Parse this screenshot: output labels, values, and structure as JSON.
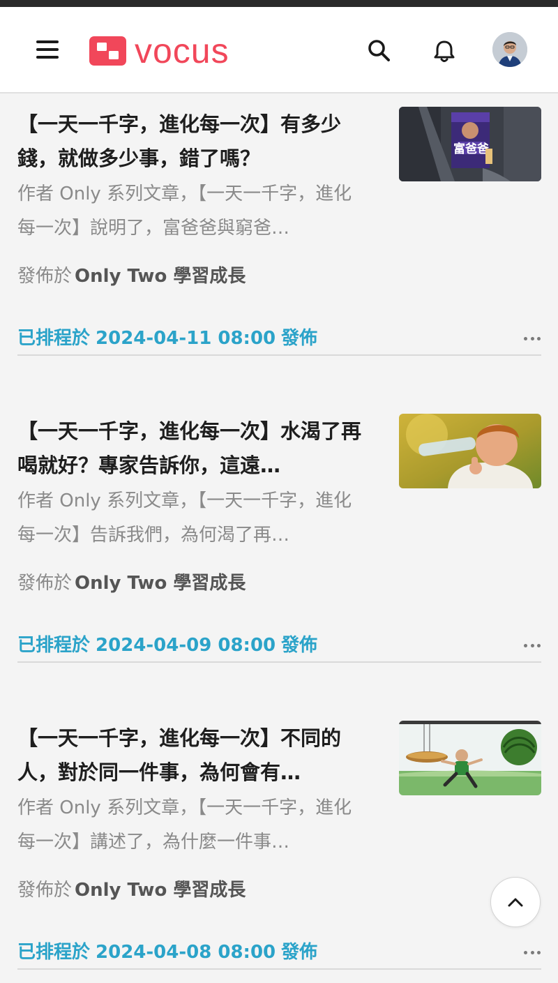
{
  "app": {
    "logo_text": "vocus",
    "brand_color": "#f1475a",
    "accent_color": "#2ba3c9",
    "icons": [
      "hamburger-menu-icon",
      "search-icon",
      "bell-icon",
      "avatar",
      "more-icon",
      "chevron-up-icon"
    ]
  },
  "articles": [
    {
      "title": "【一天一千字，進化每一次】有多少錢，就做多少事，錯了嗎？",
      "excerpt": "作者 Only 系列文章，【一天一千字，進化每一次】說明了，富爸爸與窮爸…",
      "published_label": "發佈於",
      "publication": "Only Two 學習成長",
      "schedule_prefix": "已排程於",
      "schedule_datetime": "2024-04-11 08:00",
      "schedule_suffix": "發佈"
    },
    {
      "title": "【一天一千字，進化每一次】水渴了再喝就好？專家告訴你，這遠…",
      "excerpt": "作者 Only 系列文章，【一天一千字，進化每一次】告訴我們，為何渴了再…",
      "published_label": "發佈於",
      "publication": "Only Two 學習成長",
      "schedule_prefix": "已排程於",
      "schedule_datetime": "2024-04-09 08:00",
      "schedule_suffix": "發佈"
    },
    {
      "title": "【一天一千字，進化每一次】不同的人，對於同一件事，為何會有…",
      "excerpt": "作者 Only 系列文章，【一天一千字，進化每一次】講述了，為什麼一件事…",
      "published_label": "發佈於",
      "publication": "Only Two 學習成長",
      "schedule_prefix": "已排程於",
      "schedule_datetime": "2024-04-08 08:00",
      "schedule_suffix": "發佈"
    }
  ]
}
